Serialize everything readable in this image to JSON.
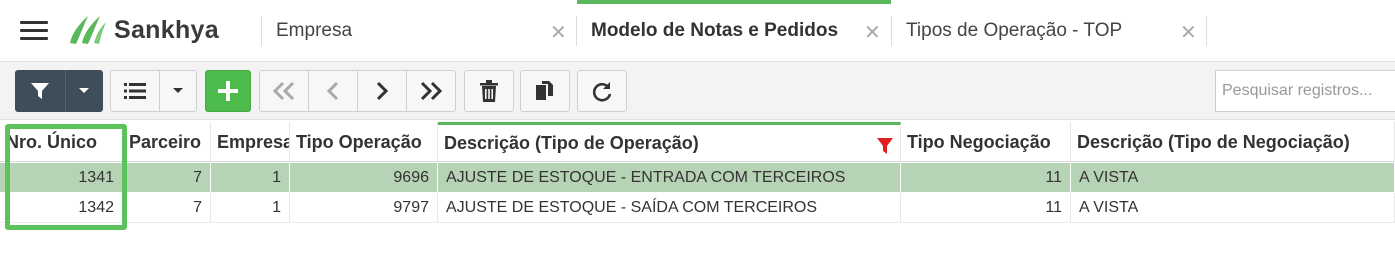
{
  "brand": {
    "name": "Sankhya",
    "accent": "#5cb85c"
  },
  "tabs": [
    {
      "label": "Empresa",
      "close": "✕",
      "active": false
    },
    {
      "label": "Modelo de Notas e Pedidos",
      "close": "✕",
      "active": true
    },
    {
      "label": "Tipos de Operação - TOP",
      "close": "✕",
      "active": false
    }
  ],
  "toolbar": {
    "buttons": [
      "filter-icon",
      "dropdown-caret-icon",
      "list-icon",
      "dropdown-caret-icon",
      "add-icon",
      "first-page-icon",
      "previous-icon",
      "next-icon",
      "last-page-icon",
      "trash-icon",
      "copy-icon",
      "refresh-icon"
    ],
    "search_placeholder": "Pesquisar registros..."
  },
  "grid": {
    "columns": [
      "Nro. Único",
      "Parceiro",
      "Empresa",
      "Tipo Operação",
      "Descrição (Tipo de Operação)",
      "Tipo Negociação",
      "Descrição (Tipo de Negociação)"
    ],
    "filtered_column": "Descrição (Tipo de Operação)",
    "rows": [
      {
        "nro_unico": "1341",
        "parceiro": "7",
        "empresa": "1",
        "tipo_operacao": "9696",
        "descricao_top": "AJUSTE DE ESTOQUE - ENTRADA COM TERCEIROS",
        "tipo_negociacao": "11",
        "descricao_neg": "A VISTA",
        "selected": true
      },
      {
        "nro_unico": "1342",
        "parceiro": "7",
        "empresa": "1",
        "tipo_operacao": "9797",
        "descricao_top": "AJUSTE DE ESTOQUE - SAÍDA COM TERCEIROS",
        "tipo_negociacao": "11",
        "descricao_neg": "A VISTA",
        "selected": false
      }
    ]
  },
  "colors": {
    "selected_row": "#b7d3b5",
    "highlight": "#5cc35c",
    "filter_marker": "#e02020"
  }
}
